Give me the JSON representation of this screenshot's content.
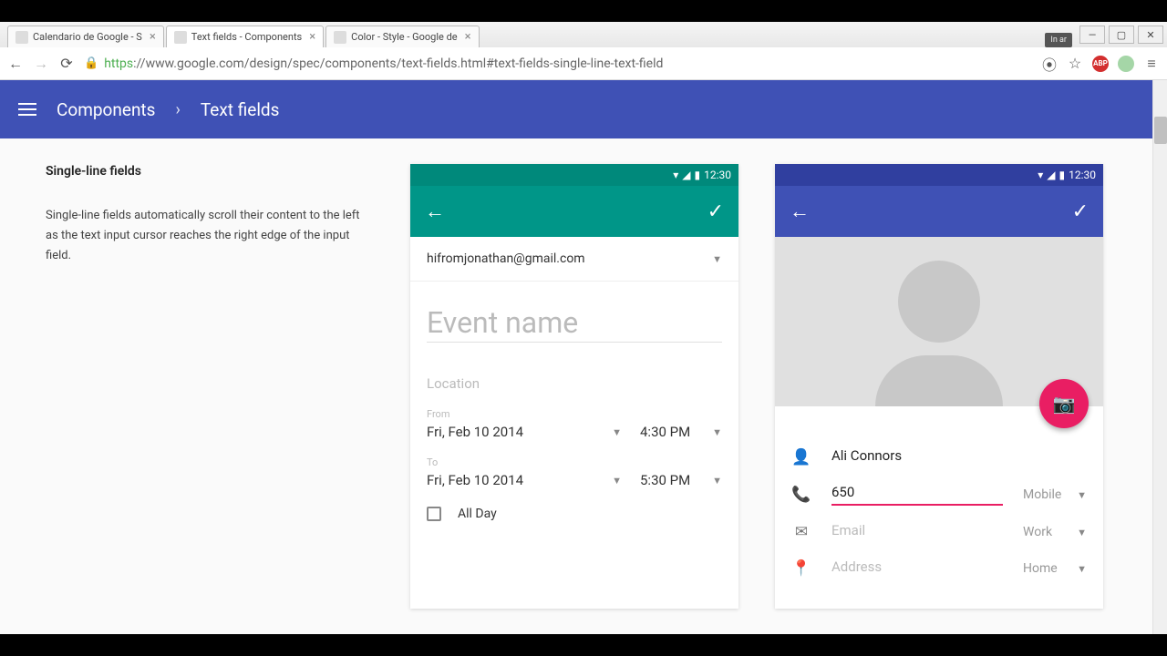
{
  "browser": {
    "tabs": [
      {
        "title": "Calendario de Google - S"
      },
      {
        "title": "Text fields - Components"
      },
      {
        "title": "Color - Style - Google de"
      }
    ],
    "url_scheme": "https",
    "url_rest": "://www.google.com/design/spec/components/text-fields.html#text-fields-single-line-text-field",
    "incognito": "In ar"
  },
  "appbar": {
    "crumb1": "Components",
    "crumb2": "Text fields"
  },
  "explain": {
    "title": "Single-line fields",
    "body": "Single-line fields automatically scroll their content to the left as the text input cursor reaches the right edge of the input field."
  },
  "status_time": "12:30",
  "phone_green": {
    "account": "hifromjonathan@gmail.com",
    "event_name_placeholder": "Event name",
    "location_placeholder": "Location",
    "from_label": "From",
    "from_date": "Fri, Feb 10 2014",
    "from_time": "4:30 PM",
    "to_label": "To",
    "to_date": "Fri, Feb 10 2014",
    "to_time": "5:30 PM",
    "all_day": "All Day"
  },
  "phone_blue": {
    "name": "Ali Connors",
    "phone_value": "650",
    "phone_type": "Mobile",
    "email_placeholder": "Email",
    "email_type": "Work",
    "address_placeholder": "Address",
    "address_type": "Home"
  }
}
